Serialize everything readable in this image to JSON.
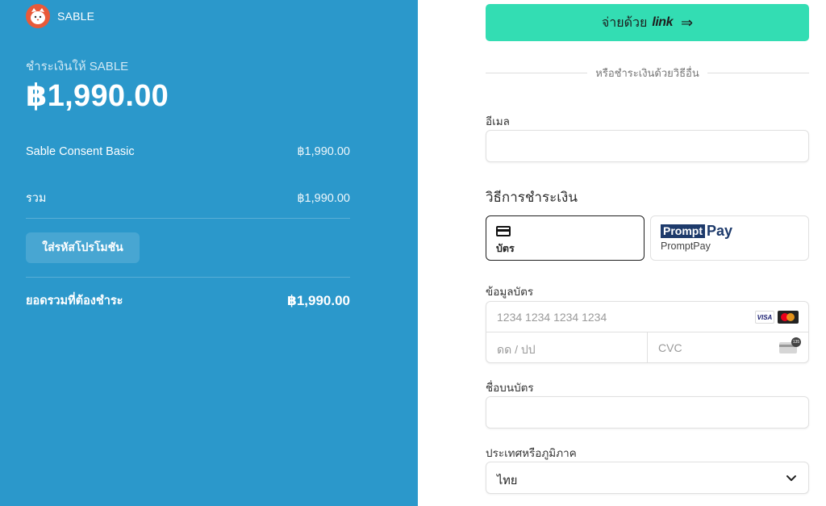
{
  "summary": {
    "brand_name": "SABLE",
    "pay_to_label": "ชำระเงินให้ SABLE",
    "total_amount": "฿1,990.00",
    "line_item": {
      "name": "Sable Consent Basic",
      "price": "฿1,990.00"
    },
    "subtotal": {
      "label": "รวม",
      "value": "฿1,990.00"
    },
    "promo_button": "ใส่รหัสโปรโมชัน",
    "total_due": {
      "label": "ยอดรวมที่ต้องชำระ",
      "value": "฿1,990.00"
    }
  },
  "checkout": {
    "link_button": {
      "prefix": "จ่ายด้วย",
      "word": "link",
      "arrow": "⇒"
    },
    "or_divider": "หรือชำระเงินด้วยวิธีอื่น",
    "email_label": "อีเมล",
    "email_value": "",
    "payment_method_title": "วิธีการชำระเงิน",
    "methods": [
      {
        "label": "บัตร",
        "icon": "card-icon",
        "selected": true
      },
      {
        "label": "PromptPay",
        "logo_prompt": "Prompt",
        "logo_pay": "Pay",
        "selected": false
      }
    ],
    "card_info_label": "ข้อมูลบัตร",
    "card_number_placeholder": "1234 1234 1234 1234",
    "expiry_placeholder": "ดด / ปป",
    "cvc_placeholder": "CVC",
    "card_brands": [
      "VISA",
      "mastercard"
    ],
    "cvc_icon_text": "135",
    "name_label": "ชื่อบนบัตร",
    "name_value": "",
    "country_label": "ประเทศหรือภูมิภาค",
    "country_value": "ไทย"
  },
  "colors": {
    "left_panel": "#2b98cb",
    "link_button": "#33ddb3",
    "logo": "#e85a3a"
  }
}
